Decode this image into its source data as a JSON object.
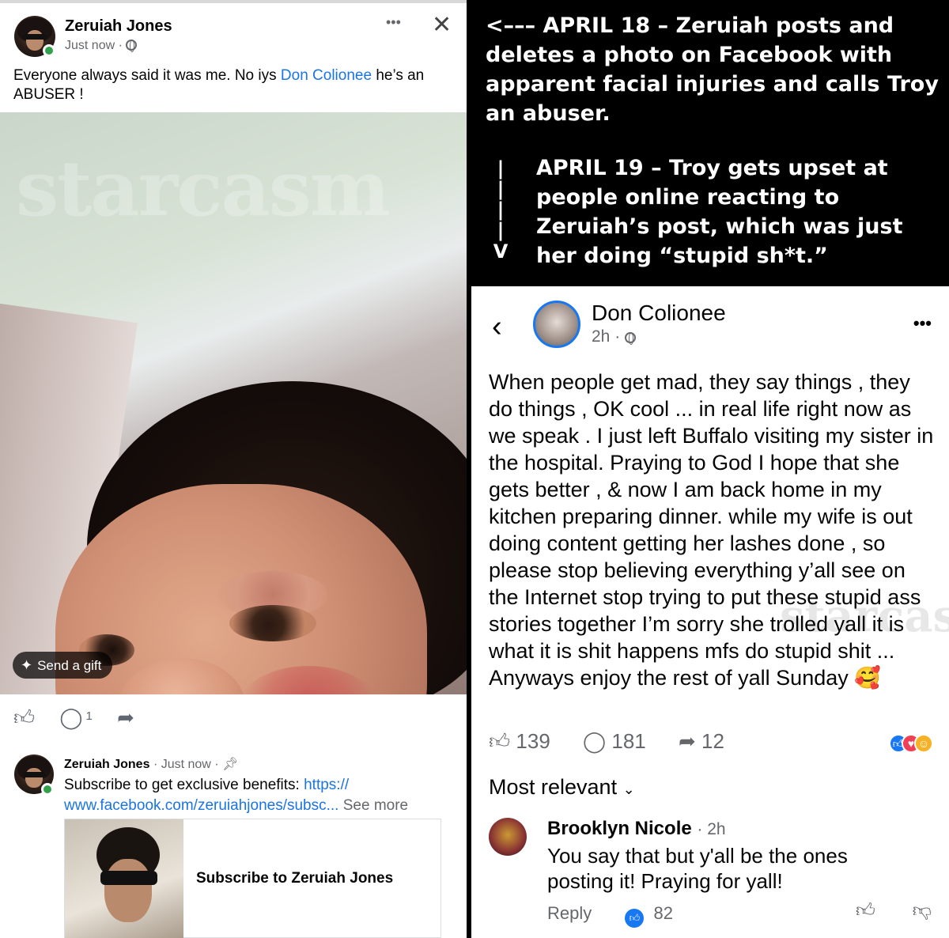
{
  "left_post": {
    "author": "Zeruiah Jones",
    "time": "Just now ·",
    "more": "•••",
    "close": "✕",
    "text_prefix": "Everyone always said it was me. No iys ",
    "mention": "Don Colionee",
    "text_suffix": " he’s an ABUSER !",
    "watermark": "starcasm",
    "gift_label": "Send a gift",
    "comment_count": "1"
  },
  "subscription": {
    "author": "Zeruiah Jones",
    "meta": "· Just now ·",
    "text": "Subscribe to get exclusive benefits: ",
    "link": "https:// www.facebook.com/zeruiahjones/subsc...",
    "see_more": " See more",
    "card_title": "Subscribe to Zeruiah Jones"
  },
  "caption": {
    "first": "<––– APRIL 18 – Zeruiah posts and deletes a photo on Facebook with apparent facial injuries and calls Troy an abuser.",
    "second": "APRIL 19 – Troy gets upset at people online reacting to Zeruiah’s post, which was just her doing “stupid sh*t.”",
    "arrow_bars": "| | | |",
    "arrow_head": "V"
  },
  "right_post": {
    "author": "Don Colionee",
    "time": "2h ·",
    "more": "•••",
    "text": "When people get mad, they say things , they do things , OK cool ... in real life right now as we speak . I just left Buffalo visiting my sister in the hospital. Praying to God I hope that she gets better , & now I am back home in my kitchen preparing dinner. while my wife is out doing content getting her lashes done , so please stop believing everything y’all see on the Internet stop trying to put these stupid ass stories together I’m sorry she trolled yall it is what it is shit happens mfs do stupid shit ...",
    "text2": "Anyways enjoy the rest of yall Sunday 🥰",
    "likes": "139",
    "comments": "181",
    "shares": "12",
    "sort_label": "Most relevant",
    "watermark": "starcasm"
  },
  "comment": {
    "author": "Brooklyn Nicole",
    "time": "· 2h",
    "text": "You say that but y'all be the ones posting it! Praying for yall!",
    "reply": "Reply",
    "likes": "82"
  }
}
